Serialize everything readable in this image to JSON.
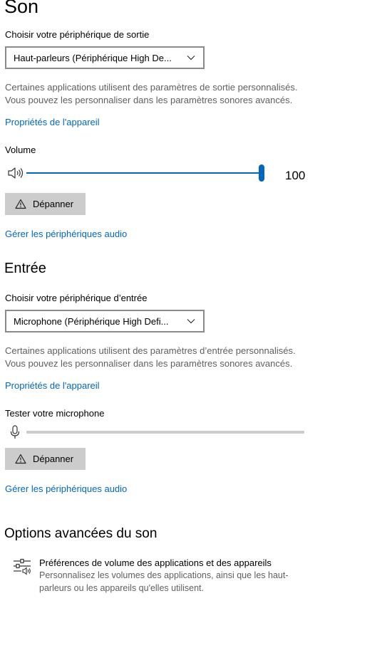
{
  "page_title": "Son",
  "output": {
    "choose_label": "Choisir votre périphérique de sortie",
    "device_value": "Haut-parleurs (Périphérique High De...",
    "description_line1": "Certaines applications utilisent des paramètres de sortie personnalisés.",
    "description_line2": "Vous pouvez les personnaliser dans les paramètres sonores avancés.",
    "device_properties_link": "Propriétés de l'appareil",
    "volume_label": "Volume",
    "volume_value": "100",
    "volume_level_percent": 100,
    "troubleshoot_label": "Dépanner",
    "manage_devices_link": "Gérer les périphériques audio"
  },
  "input": {
    "section_title": "Entrée",
    "choose_label": "Choisir votre périphérique d’entrée",
    "device_value": "Microphone (Périphérique High Defi...",
    "description_line1": "Certaines applications utilisent des paramètres d’entrée personnalisés.",
    "description_line2": "Vous pouvez les personnaliser dans les paramètres sonores avancés.",
    "device_properties_link": "Propriétés de l'appareil",
    "test_label": "Tester votre microphone",
    "mic_level_percent": 0,
    "troubleshoot_label": "Dépanner",
    "manage_devices_link": "Gérer les périphériques audio"
  },
  "advanced": {
    "section_title": "Options avancées du son",
    "app_volume_title": "Préférences de volume des applications et des appareils",
    "app_volume_desc": "Personnalisez les volumes des applications, ainsi que les haut-parleurs ou les appareils qu'elles utilisent."
  },
  "icons": {
    "chevron": "chevron-down-icon",
    "speaker": "speaker-icon",
    "warning": "warning-icon",
    "microphone": "microphone-icon",
    "mixer": "app-volume-mixer-icon"
  },
  "colors": {
    "accent": "#0067c0",
    "button_bg": "#cccccc",
    "secondary_text": "#5f5f5f"
  }
}
